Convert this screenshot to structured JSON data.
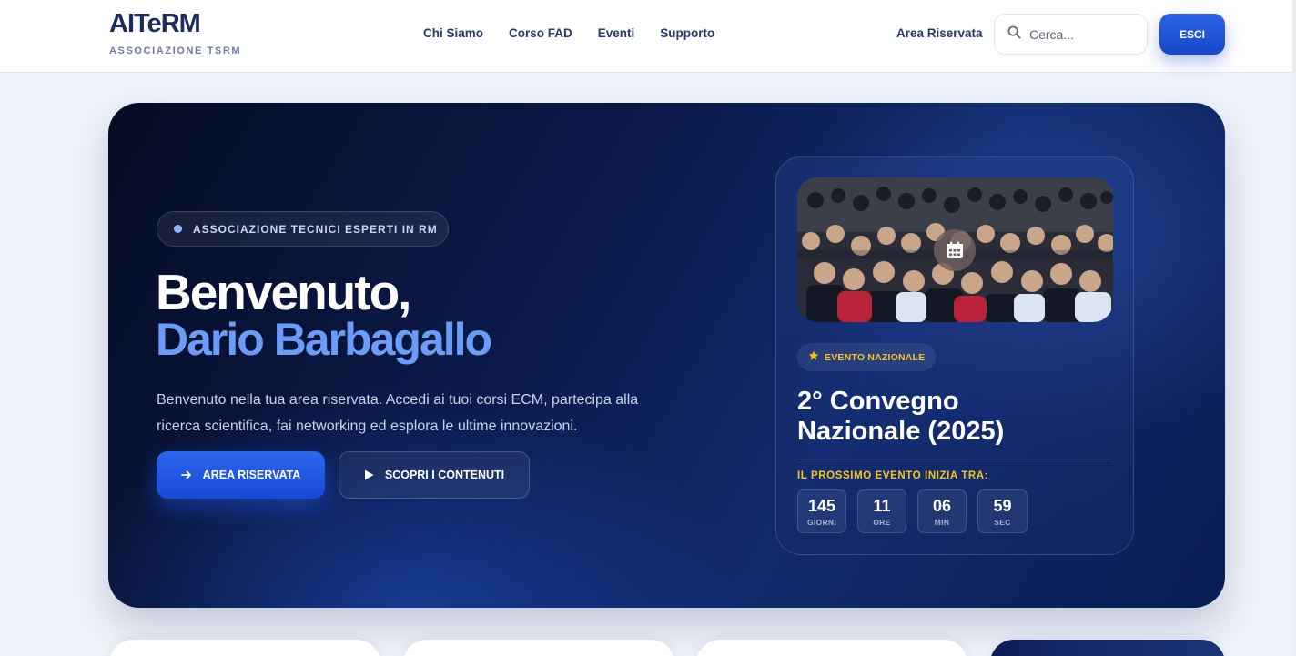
{
  "header": {
    "logo_title": "AITeRM",
    "logo_subtitle": "ASSOCIAZIONE TSRM",
    "nav": [
      "Chi Siamo",
      "Corso FAD",
      "Eventi",
      "Supporto"
    ],
    "area_link": "Area Riservata",
    "search_placeholder": "Cerca...",
    "logout_label": "ESCI"
  },
  "hero": {
    "badge": "ASSOCIAZIONE TECNICI ESPERTI IN RM",
    "greeting": "Benvenuto,",
    "user_name": "Dario Barbagallo",
    "intro": "Benvenuto nella tua area riservata. Accedi ai tuoi corsi ECM, partecipa alla ricerca scientifica, fai networking ed esplora le ultime innovazioni.",
    "primary_button": "AREA RISERVATA",
    "secondary_button": "SCOPRI I CONTENUTI"
  },
  "event": {
    "tag": "EVENTO NAZIONALE",
    "title": "2° Convegno Nazionale (2025)",
    "next_label": "IL PROSSIMO EVENTO INIZIA TRA:",
    "countdown": [
      {
        "value": "145",
        "unit": "GIORNI"
      },
      {
        "value": "11",
        "unit": "ORE"
      },
      {
        "value": "06",
        "unit": "MIN"
      },
      {
        "value": "59",
        "unit": "SEC"
      }
    ]
  },
  "colors": {
    "brand_blue": "#1f55dd",
    "accent_light_blue": "#6b9cf8",
    "accent_yellow": "#f5c518",
    "hero_dark": "#0b1a4a"
  },
  "icons": {
    "search": "search-icon",
    "arrow": "arrow-right-icon",
    "play": "play-icon",
    "star": "star-icon",
    "calendar": "calendar-icon"
  }
}
